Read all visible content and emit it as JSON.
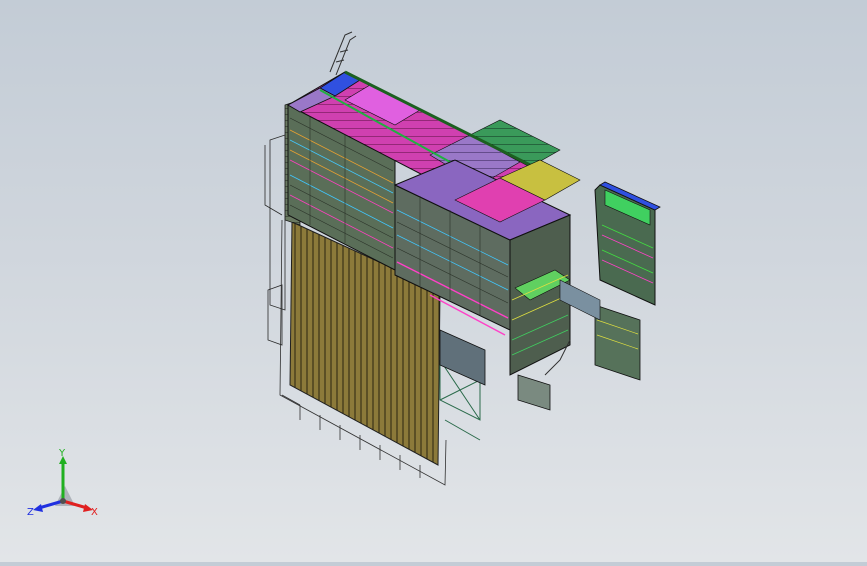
{
  "viewport": {
    "background_top": "#c3ccd6",
    "background_bottom": "#e2e5e8"
  },
  "triad": {
    "x_label": "X",
    "y_label": "Y",
    "z_label": "Z",
    "x_color": "#e02020",
    "y_color": "#20b020",
    "z_color": "#2030e0"
  },
  "model": {
    "colors": [
      "#ff40c8",
      "#e060e0",
      "#40d0ff",
      "#ffa020",
      "#40e040",
      "#3050ff",
      "#c8a040",
      "#d0e030",
      "#8040c0"
    ]
  }
}
